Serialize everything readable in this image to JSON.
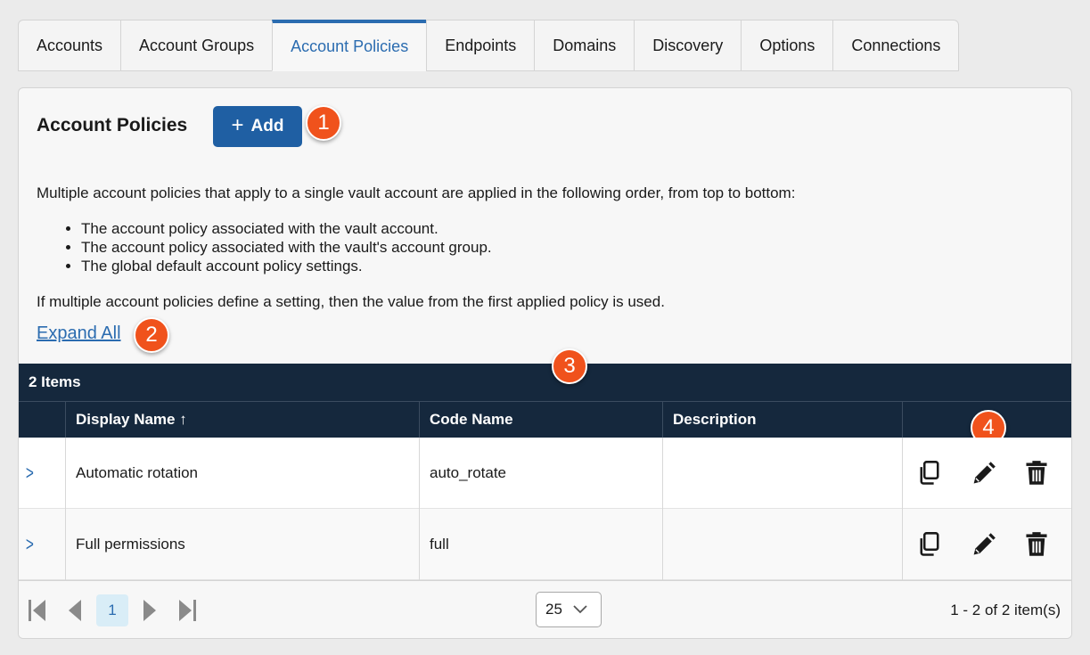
{
  "tabs": [
    "Accounts",
    "Account Groups",
    "Account Policies",
    "Endpoints",
    "Domains",
    "Discovery",
    "Options",
    "Connections"
  ],
  "active_tab": "Account Policies",
  "page": {
    "title": "Account Policies",
    "add_label": "Add",
    "intro": "Multiple account policies that apply to a single vault account are applied in the following order, from top to bottom:",
    "bullets": [
      "The account policy associated with the vault account.",
      "The account policy associated with the vault's account group.",
      "The global default account policy settings."
    ],
    "note": "If multiple account policies define a setting, then the value from the first applied policy is used.",
    "expand_all": "Expand All"
  },
  "callouts": [
    "1",
    "2",
    "3",
    "4"
  ],
  "grid": {
    "count_label": "2 Items",
    "columns": [
      "Display Name ↑",
      "Code Name",
      "Description",
      ""
    ],
    "rows": [
      {
        "display_name": "Automatic rotation",
        "code_name": "auto_rotate",
        "description": ""
      },
      {
        "display_name": "Full permissions",
        "code_name": "full",
        "description": ""
      }
    ],
    "row_actions": [
      "copy-icon",
      "edit-pencil-icon",
      "trash-icon"
    ]
  },
  "pager": {
    "current_page": "1",
    "page_size": "25",
    "info": "1 - 2 of 2 item(s)"
  },
  "colors": {
    "accent": "#1f5fa3",
    "grid_header": "#15283d",
    "callout": "#f0521c"
  }
}
